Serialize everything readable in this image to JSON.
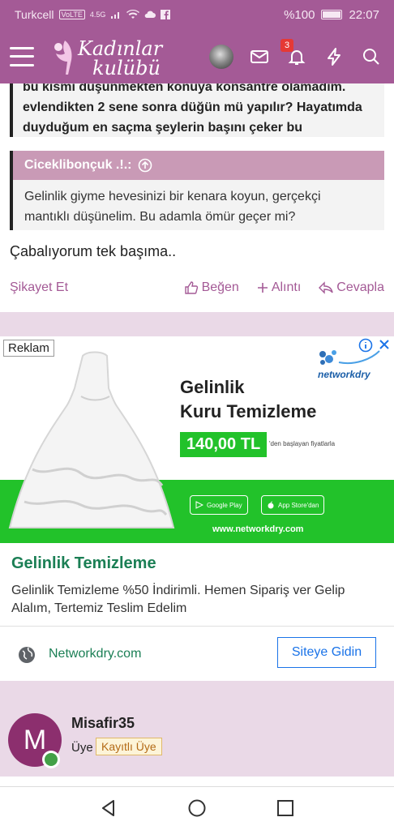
{
  "status_bar": {
    "carrier": "Turkcell",
    "volte": "VoLTE",
    "network": "4.5G",
    "battery": "%100",
    "time": "22:07"
  },
  "header": {
    "logo_line1": "Kadınlar",
    "logo_line2": "kulübü",
    "notification_count": "3",
    "colors": {
      "brand": "#a45a96"
    }
  },
  "quote1": {
    "line1": "bu kısmı düşünmekten konuya konsantre olamadım.",
    "line2": "evlendikten 2 sene sonra düğün mü yapılır? Hayatımda",
    "line3": "duyduğum en saçma şeylerin başını çeker bu"
  },
  "quote2": {
    "author": "Ciceklibonçuk .!.:",
    "line1": "Gelinlik giyme hevesinizi bir kenara koyun, gerçekçi",
    "line2": "mantıklı düşünelim. Bu adamla ömür geçer mi?"
  },
  "post": {
    "text": "Çabalıyorum tek başıma..",
    "report": "Şikayet Et",
    "like": "Beğen",
    "quote": "Alıntı",
    "reply": "Cevapla"
  },
  "ad": {
    "label": "Reklam",
    "brand": "networkdry",
    "title_line1": "Gelinlik",
    "title_line2": "Kuru Temizleme",
    "price": "140,00 TL",
    "price_note": "'den başlayan fiyatlarla",
    "google_play": "Google Play",
    "app_store": "App Store'dan",
    "url_banner": "www.networkdry.com",
    "headline": "Gelinlik Temizleme",
    "description": "Gelinlik Temizleme %50 İndirimli. Hemen Sipariş ver Gelip Alalım, Tertemiz Teslim Edelim",
    "site": "Networkdry.com",
    "cta": "Siteye Gidin"
  },
  "user": {
    "initial": "M",
    "name": "Misafir35",
    "role": "Üye",
    "badge": "Kayıtlı Üye"
  }
}
